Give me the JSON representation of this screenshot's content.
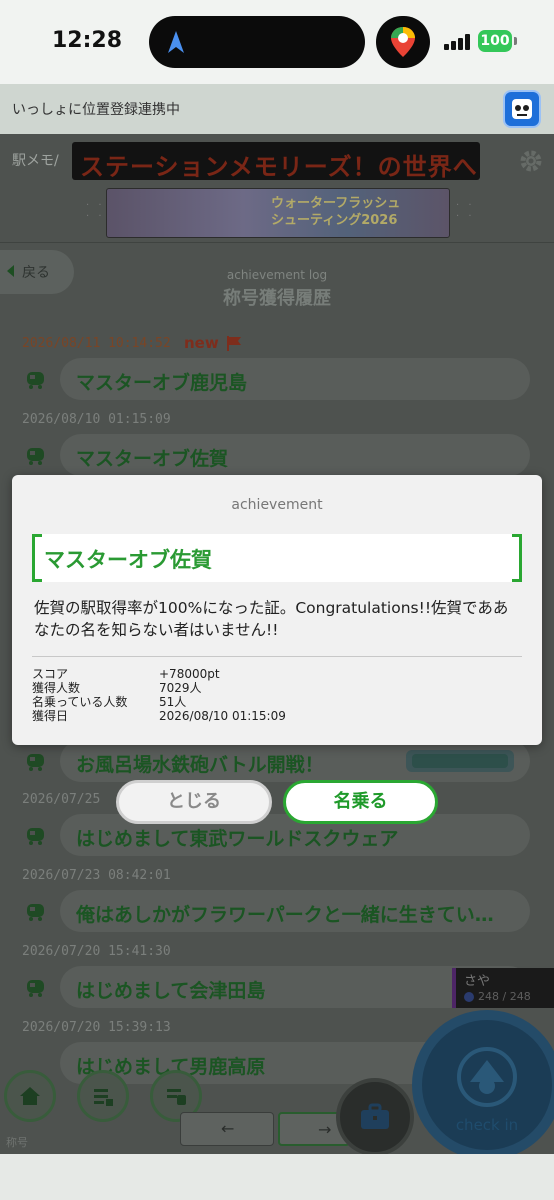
{
  "status_bar": {
    "time": "12:28",
    "battery": "100"
  },
  "share_banner": {
    "text": "いっしょに位置登録連携中"
  },
  "header": {
    "memo_label": "駅メモ/",
    "ticker": "ステーションメモリーズ！の世界へ",
    "event_banner": "ウォーターフラッシュ\nシューティング2026"
  },
  "nav": {
    "back_label": "戻る"
  },
  "log": {
    "subtitle": "achievement log",
    "title": "称号獲得履歴",
    "new_tag": "new",
    "entries": [
      {
        "date": "2026/08/11 10:14:52",
        "title": "マスターオブ鹿児島"
      },
      {
        "date": "2026/08/10 01:15:09",
        "title": "マスターオブ佐賀"
      },
      {
        "date": "",
        "title": "お風呂場水鉄砲バトル開戦！"
      },
      {
        "date": "2026/07/25",
        "title": "はじめまして東武ワールドスクウェア"
      },
      {
        "date": "2026/07/23 08:42:01",
        "title": "俺はあしかがフラワーパークと一緒に生きてい…"
      },
      {
        "date": "2026/07/20 15:41:30",
        "title": "はじめまして会津田島"
      },
      {
        "date": "2026/07/20 15:39:13",
        "title": "はじめまして男鹿高原"
      }
    ]
  },
  "modal": {
    "header": "achievement",
    "title": "マスターオブ佐賀",
    "description": "佐賀の駅取得率が100%になった証。Congratulations!!佐賀でああなたの名を知らない者はいません!!",
    "stats": [
      {
        "label": "スコア",
        "value": "+78000pt"
      },
      {
        "label": "獲得人数",
        "value": "7029人"
      },
      {
        "label": "名乗っている人数",
        "value": "51人"
      },
      {
        "label": "獲得日",
        "value": "2026/08/10 01:15:09"
      }
    ],
    "close_label": "とじる",
    "claim_label": "名乗る"
  },
  "footer": {
    "nickname_label": "称号",
    "character_name": "さや",
    "hp": "248 / 248",
    "checkin_label": "check in"
  },
  "colors": {
    "accent": "#2aa732",
    "dim_overlay": "#4e524f",
    "checkin": "#244b68"
  }
}
